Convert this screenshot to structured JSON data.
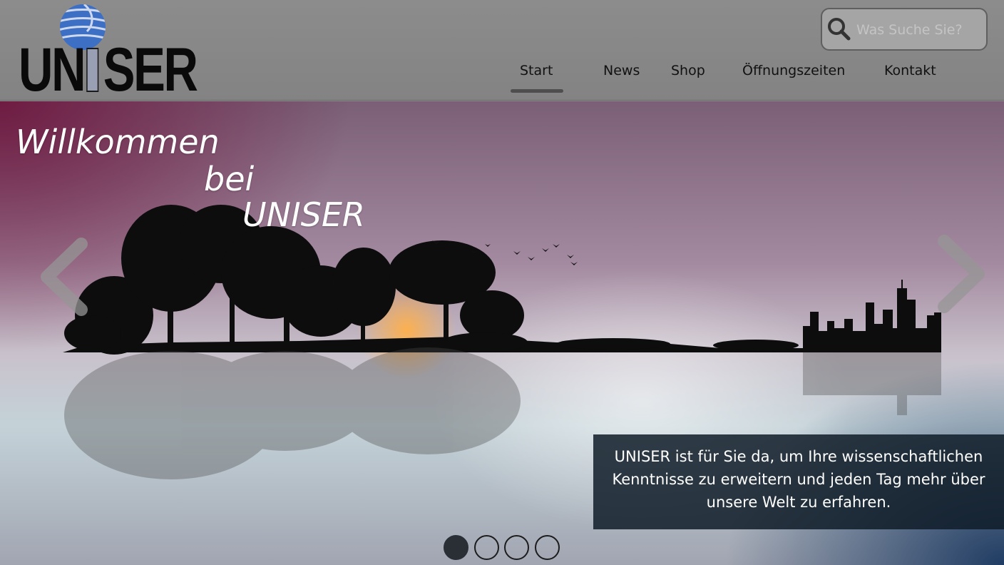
{
  "brand": {
    "logo_text_before": "UN",
    "logo_text_after": "SER",
    "globe_color": "#3d6fc4"
  },
  "search": {
    "placeholder": "Was Suche Sie?"
  },
  "nav": {
    "items": [
      {
        "label": "Start",
        "active": true
      },
      {
        "label": "News"
      },
      {
        "label": "Shop"
      },
      {
        "label": "Öffnungszeiten"
      },
      {
        "label": "Kontakt"
      }
    ]
  },
  "hero": {
    "welcome_line1": "Willkommen",
    "welcome_line2": "bei",
    "welcome_line3": "UNISER",
    "caption_line1": "UNISER ist für Sie da, um Ihre wissenschaftlichen",
    "caption_line2": "Kenntnisse zu erweitern und jeden Tag mehr über",
    "caption_line3": "unsere Welt zu erfahren.",
    "slides_total": 4,
    "active_slide": 1
  },
  "icons": {
    "prev": "chevron-left-icon",
    "next": "chevron-right-icon",
    "search": "search-icon",
    "logo": "globe-icon"
  }
}
